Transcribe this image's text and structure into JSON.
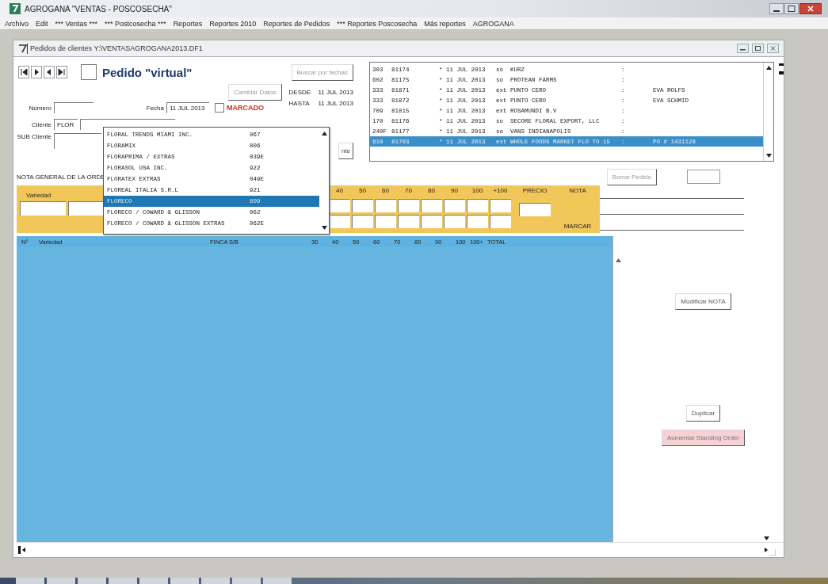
{
  "window": {
    "title": "AGROGANA \"VENTAS - POSCOSECHA\""
  },
  "menu": [
    "Archivo",
    "Edit",
    "*** Ventas ***",
    "*** Postcosecha ***",
    "Reportes",
    "Reportes 2010",
    "Reportes de Pedidos",
    "*** Reportes Poscosecha",
    "Más reportes",
    "AGROGANA"
  ],
  "child_window": {
    "title": "Pedidos de clientes Y:\\VENTASAGROGANA2013.DF1"
  },
  "header": {
    "virtual_checked": false,
    "virtual_label": "Pedido \"virtual\"",
    "search_button": "Buscar por fechas",
    "change_button": "Cambiar Datos",
    "desde_label": "DESDE",
    "desde_value": "11 JUL 2013",
    "hasta_label": "HASTA",
    "hasta_value": "11 JUL 2013",
    "numero_label": "Número",
    "fecha_label": "Fecha",
    "fecha_value": "11 JUL 2013",
    "marcado_label": "MARCADO",
    "marcado_checked": false,
    "cliente_label": "Cliente",
    "cliente_value": "FLOR",
    "sub_cliente_label": "SUB Cliente",
    "cut_button": "nte",
    "nota_general_label": "NOTA GENERAL DE LA ORDE",
    "delete_button": "Borrar Pedido"
  },
  "orders": [
    {
      "code": "303",
      "number": "81174",
      "date": "* 11 JUL 2013",
      "type": "so",
      "client": "KURZ",
      "sep": ":",
      "selected": false
    },
    {
      "code": "602",
      "number": "81175",
      "date": "* 11 JUL 2013",
      "type": "so",
      "client": "PROTEAN FARMS",
      "sep": ":",
      "selected": false
    },
    {
      "code": "333",
      "number": "81871",
      "date": "* 11 JUL 2013",
      "type": "ext",
      "client": "PUNTO CERO",
      "sep": ":",
      "note": "EVA ROLFS",
      "selected": false
    },
    {
      "code": "333",
      "number": "81872",
      "date": "* 11 JUL 2013",
      "type": "ext",
      "client": "PUNTO CERO",
      "sep": ":",
      "note": "EVA SCHMID",
      "selected": false
    },
    {
      "code": "709",
      "number": "81815",
      "date": "* 11 JUL 2013",
      "type": "ext",
      "client": "ROSAMUNDI B.V",
      "sep": ":",
      "selected": false
    },
    {
      "code": "170",
      "number": "81176",
      "date": "* 11 JUL 2013",
      "type": "so",
      "client": "SECORE FLORAL EXPORT, LLC",
      "sep": ":",
      "selected": false
    },
    {
      "code": "240F",
      "number": "81177",
      "date": "* 11 JUL 2013",
      "type": "so",
      "client": "VANS INDIANAPOLIS",
      "sep": ":",
      "selected": false
    },
    {
      "code": "810",
      "number": "81703",
      "date": "* 11 JUL 2013",
      "type": "ext",
      "client": "WHOLE FOODS MARKET FLO TO 15",
      "sep": ":",
      "note": "PO # 1431128",
      "selected": true
    }
  ],
  "client_dropdown": [
    {
      "name": "FLORAL TRENDS MIAMI INC.",
      "code": "067",
      "selected": false
    },
    {
      "name": "FLORAMIX",
      "code": "806",
      "selected": false
    },
    {
      "name": "FLORAPRIMA / EXTRAS",
      "code": "039E",
      "selected": false
    },
    {
      "name": "FLORASOL USA INC.",
      "code": "922",
      "selected": false
    },
    {
      "name": "FLORATEX EXTRAS",
      "code": "049E",
      "selected": false
    },
    {
      "name": "FLOREAL ITALIA S.R.L",
      "code": "921",
      "selected": false
    },
    {
      "name": "FLORECO",
      "code": "809",
      "selected": true
    },
    {
      "name": "FLORECO  / COWARD & GLISSON",
      "code": "062",
      "selected": false
    },
    {
      "name": "FLORECO / COWARD & GLISSON EXTRAS",
      "code": "062E",
      "selected": false
    }
  ],
  "entry": {
    "variedad_label": "Variedad",
    "sizes": [
      "40",
      "50",
      "60",
      "70",
      "80",
      "90",
      "100",
      "+100"
    ],
    "price_label": "PRECIO",
    "nota_label": "NOTA",
    "marcar_label": "MARCAR"
  },
  "grid": {
    "columns": [
      "Nº",
      "Variedad",
      "FINCA",
      "S/B",
      "30",
      "40",
      "50",
      "60",
      "70",
      "80",
      "90",
      "100",
      "100+",
      "TOTAL"
    ]
  },
  "side_buttons": [
    {
      "label": "Modificar NOTA",
      "kind": "plain"
    },
    {
      "label": "Duplicar",
      "kind": "plain"
    },
    {
      "label": "Aumentar Standing Order",
      "kind": "pink"
    }
  ]
}
